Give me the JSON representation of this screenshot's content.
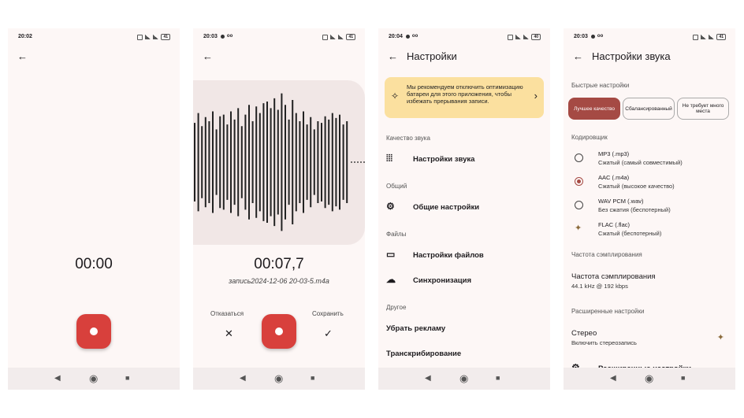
{
  "phone1": {
    "time": "20:02",
    "battery": "41",
    "timer": "00:00"
  },
  "phone2": {
    "time": "20:03",
    "battery": "41",
    "timer": "00:07,7",
    "filename": "запись2024-12-06 20-03-5.m4a",
    "cancel_label": "Отказаться",
    "save_label": "Сохранить",
    "wave_heights": [
      0.48,
      0.6,
      0.44,
      0.55,
      0.5,
      0.62,
      0.4,
      0.56,
      0.58,
      0.46,
      0.62,
      0.52,
      0.66,
      0.44,
      0.58,
      0.7,
      0.5,
      0.68,
      0.6,
      0.72,
      0.74,
      0.66,
      0.78,
      0.64,
      0.84,
      0.7,
      0.52,
      0.76,
      0.6,
      0.5,
      0.62,
      0.46,
      0.55,
      0.4,
      0.5,
      0.48,
      0.56,
      0.52,
      0.6,
      0.54,
      0.58,
      0.46,
      0.5
    ]
  },
  "phone3": {
    "time": "20:04",
    "battery": "40",
    "title": "Настройки",
    "banner": "Мы рекомендуем отключить оптимизацию батареи для этого приложения, чтобы избежать прерывания записи.",
    "sections": {
      "quality": "Качество звука",
      "general": "Общий",
      "files": "Файлы",
      "other": "Другое"
    },
    "items": {
      "sound": "Настройки звука",
      "general": "Общие настройки",
      "files": "Настройки файлов",
      "sync": "Синхронизация",
      "ads": "Убрать рекламу",
      "transcribe": "Транскрибирование"
    }
  },
  "phone4": {
    "time": "20:03",
    "battery": "41",
    "title": "Настройки звука",
    "quick": "Быстрые настройки",
    "chips": [
      "Лучшее качество",
      "Сбалансированный",
      "Не требует много места"
    ],
    "encoder": "Кодировщик",
    "options": [
      {
        "name": "MP3 (.mp3)",
        "desc": "Сжатый (самый совместимый)",
        "selected": false
      },
      {
        "name": "AAC (.m4a)",
        "desc": "Сжатый (высокое качество)",
        "selected": true
      },
      {
        "name": "WAV PCM (.wav)",
        "desc": "Без сжатия (беспотерный)",
        "selected": false
      },
      {
        "name": "FLAC (.flac)",
        "desc": "Сжатый (беспотерный)",
        "selected": false
      }
    ],
    "sampling_section": "Частота сэмплирования",
    "sampling_title": "Частота сэмплирования",
    "sampling_value": "44.1 kHz @ 192 kbps",
    "advanced": "Расширенные настройки",
    "stereo_title": "Стерео",
    "stereo_desc": "Включить стереозапись",
    "cut_item": "Расширенные настройки"
  }
}
